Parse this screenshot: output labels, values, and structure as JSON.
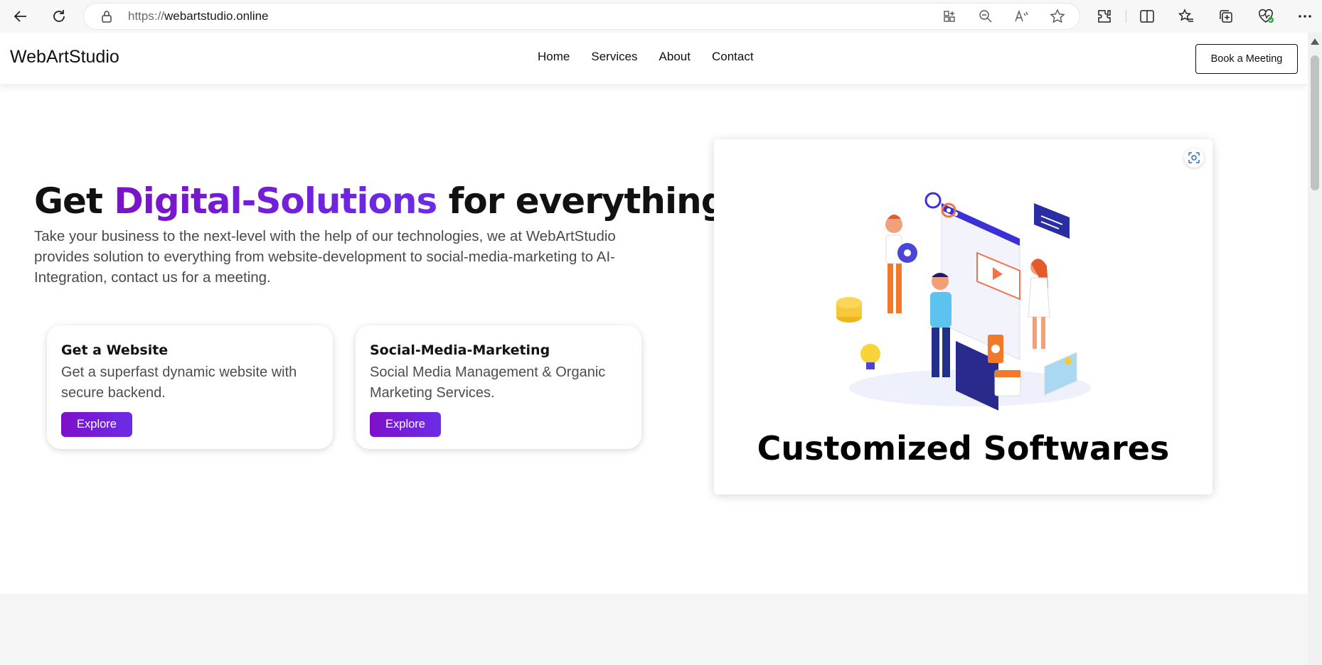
{
  "browser": {
    "url_prefix": "https://",
    "url_domain": "webartstudio.online"
  },
  "header": {
    "logo": "WebArtStudio",
    "nav": [
      "Home",
      "Services",
      "About",
      "Contact"
    ],
    "cta": "Book a Meeting"
  },
  "hero": {
    "title_start": "Get ",
    "title_accent": "Digital-Solutions",
    "title_end": " for everything.",
    "description": "Take your business to the next-level with the help of our technologies, we at WebArtStudio provides solution to everything from website-development to social-media-marketing to AI-Integration, contact us for a meeting."
  },
  "cards": [
    {
      "title": "Get a Website",
      "description": "Get a superfast dynamic website with secure backend.",
      "button": "Explore"
    },
    {
      "title": "Social-Media-Marketing",
      "description": "Social Media Management & Organic Marketing Services.",
      "button": "Explore"
    }
  ],
  "showcase": {
    "caption": "Customized Softwares"
  },
  "colors": {
    "accent_start": "#7b12c9",
    "accent_end": "#6a2ce8"
  },
  "icons": [
    "back-icon",
    "refresh-icon",
    "lock-icon",
    "app-available-icon",
    "zoom-icon",
    "read-aloud-icon",
    "favorite-star-icon",
    "extensions-icon",
    "split-screen-icon",
    "favorites-icon",
    "collections-icon",
    "browser-essentials-icon",
    "more-icon",
    "visual-search-icon"
  ]
}
